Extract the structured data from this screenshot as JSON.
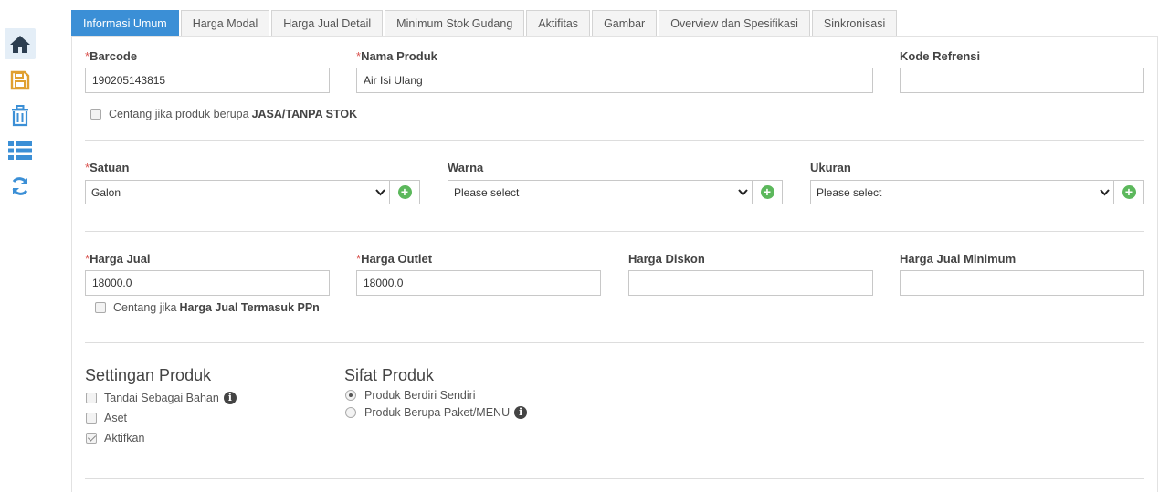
{
  "sidebar": {
    "items": [
      {
        "name": "home-icon",
        "color": "#2c3e50"
      },
      {
        "name": "save-icon",
        "color": "#e0a030"
      },
      {
        "name": "trash-icon",
        "color": "#3b8fd6"
      },
      {
        "name": "list-icon",
        "color": "#3b8fd6"
      },
      {
        "name": "refresh-icon",
        "color": "#3b8fd6"
      }
    ]
  },
  "tabs": [
    {
      "label": "Informasi Umum",
      "active": true
    },
    {
      "label": "Harga Modal"
    },
    {
      "label": "Harga Jual Detail"
    },
    {
      "label": "Minimum Stok Gudang"
    },
    {
      "label": "Aktifitas"
    },
    {
      "label": "Gambar"
    },
    {
      "label": "Overview dan Spesifikasi"
    },
    {
      "label": "Sinkronisasi"
    }
  ],
  "required_mark": "*",
  "fields": {
    "barcode": {
      "label": "Barcode",
      "value": "190205143815"
    },
    "nama_produk": {
      "label": "Nama Produk",
      "value": "Air Isi Ulang"
    },
    "kode_refrensi": {
      "label": "Kode Refrensi",
      "value": ""
    },
    "jasa_checkbox": {
      "prefix": "Centang jika produk berupa ",
      "bold": "JASA/TANPA STOK",
      "checked": false
    },
    "satuan": {
      "label": "Satuan",
      "value": "Galon"
    },
    "warna": {
      "label": "Warna",
      "value": "Please select"
    },
    "ukuran": {
      "label": "Ukuran",
      "value": "Please select"
    },
    "harga_jual": {
      "label": "Harga Jual",
      "value": "18000.0"
    },
    "harga_outlet": {
      "label": "Harga Outlet",
      "value": "18000.0"
    },
    "harga_diskon": {
      "label": "Harga Diskon",
      "value": ""
    },
    "harga_jual_minimum": {
      "label": "Harga Jual Minimum",
      "value": ""
    },
    "ppn_checkbox": {
      "prefix": "Centang jika ",
      "bold": "Harga Jual Termasuk PPn",
      "checked": false
    }
  },
  "settingan": {
    "title": "Settingan Produk",
    "items": [
      {
        "label": "Tandai Sebagai Bahan",
        "checked": false,
        "info": true
      },
      {
        "label": "Aset",
        "checked": false
      },
      {
        "label": "Aktifkan",
        "checked": true
      }
    ]
  },
  "sifat": {
    "title": "Sifat Produk",
    "options": [
      {
        "label": "Produk Berdiri Sendiri",
        "selected": true
      },
      {
        "label": "Produk Berupa Paket/MENU",
        "selected": false,
        "info": true
      }
    ]
  },
  "colors": {
    "accent": "#3b8fd6",
    "add_green": "#5cb85c",
    "required": "#d9534f"
  }
}
